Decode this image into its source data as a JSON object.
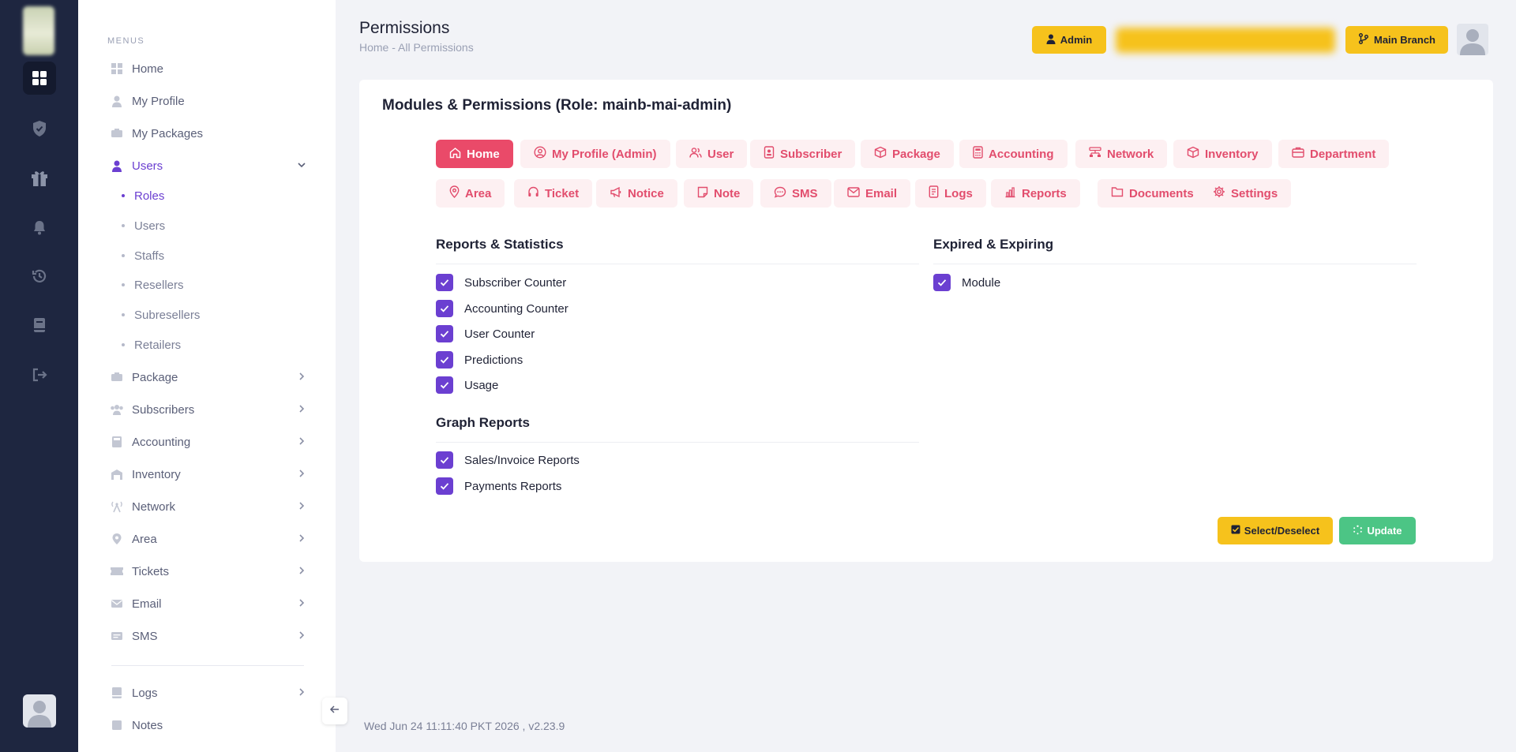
{
  "sidebar": {
    "menus_title": "MENUS",
    "items": [
      {
        "label": "Home"
      },
      {
        "label": "My Profile"
      },
      {
        "label": "My Packages"
      },
      {
        "label": "Users"
      },
      {
        "label": "Package"
      },
      {
        "label": "Subscribers"
      },
      {
        "label": "Accounting"
      },
      {
        "label": "Inventory"
      },
      {
        "label": "Network"
      },
      {
        "label": "Area"
      },
      {
        "label": "Tickets"
      },
      {
        "label": "Email"
      },
      {
        "label": "SMS"
      },
      {
        "label": "Logs"
      },
      {
        "label": "Notes"
      }
    ],
    "users_sub": [
      {
        "label": "Roles"
      },
      {
        "label": "Users"
      },
      {
        "label": "Staffs"
      },
      {
        "label": "Resellers"
      },
      {
        "label": "Subresellers"
      },
      {
        "label": "Retailers"
      }
    ]
  },
  "header": {
    "title": "Permissions",
    "breadcrumb": "Home  -  All Permissions",
    "admin_label": "Admin",
    "branch_label": "Main Branch"
  },
  "card": {
    "title": "Modules & Permissions (Role: mainb-mai-admin)",
    "tabs": [
      {
        "label": "Home",
        "icon": "home-icon",
        "active": true
      },
      {
        "label": "My Profile (Admin)",
        "icon": "user-circle-icon"
      },
      {
        "label": "User",
        "icon": "users-icon"
      },
      {
        "label": "Subscriber",
        "icon": "id-badge-icon"
      },
      {
        "label": "Package",
        "icon": "box-icon"
      },
      {
        "label": "Accounting",
        "icon": "calculator-icon"
      },
      {
        "label": "Network",
        "icon": "network-icon"
      },
      {
        "label": "Inventory",
        "icon": "box-icon"
      },
      {
        "label": "Department",
        "icon": "department-icon"
      },
      {
        "label": "Area",
        "icon": "map-pin-icon"
      },
      {
        "label": "Ticket",
        "icon": "headset-icon"
      },
      {
        "label": "Notice",
        "icon": "megaphone-icon"
      },
      {
        "label": "Note",
        "icon": "note-icon"
      },
      {
        "label": "SMS",
        "icon": "chat-icon"
      },
      {
        "label": "Email",
        "icon": "mail-icon"
      },
      {
        "label": "Logs",
        "icon": "document-icon"
      },
      {
        "label": "Reports",
        "icon": "bar-chart-icon"
      },
      {
        "label": "Documents",
        "icon": "folder-icon"
      },
      {
        "label": "Settings",
        "icon": "gear-icon"
      }
    ],
    "sections": {
      "reports_statistics": {
        "title": "Reports & Statistics",
        "items": [
          "Subscriber Counter",
          "Accounting Counter",
          "User Counter",
          "Predictions",
          "Usage"
        ]
      },
      "graph_reports": {
        "title": "Graph Reports",
        "items": [
          "Sales/Invoice Reports",
          "Payments Reports"
        ]
      },
      "expired_expiring": {
        "title": "Expired & Expiring",
        "items": [
          "Module"
        ]
      }
    },
    "select_label": "Select/Deselect",
    "update_label": "Update"
  },
  "footer": {
    "text": "Wed Jun 24 11:11:40 PKT 2026 ,    v2.23.9"
  },
  "colors": {
    "rail_bg": "#1e2640",
    "accent_purple": "#6b3fd1",
    "tab_pink": "#ea4a69",
    "yellow": "#f6c21c",
    "green": "#4cc585"
  }
}
